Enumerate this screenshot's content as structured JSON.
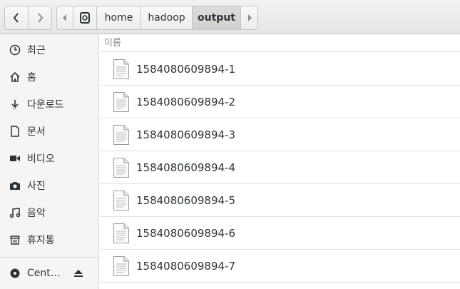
{
  "navigation": {
    "back_icon": "chevron-left-icon",
    "forward_icon": "chevron-right-icon"
  },
  "path_bar": {
    "left_arrow_icon": "scroll-left-icon",
    "root_icon": "drive-icon",
    "crumbs": [
      "home",
      "hadoop",
      "output"
    ],
    "active_crumb": "output",
    "right_arrow_icon": "scroll-right-icon"
  },
  "sidebar": {
    "items": [
      {
        "label": "최근",
        "icon": "clock-icon"
      },
      {
        "label": "홈",
        "icon": "home-icon"
      },
      {
        "label": "다운로드",
        "icon": "download-icon"
      },
      {
        "label": "문서",
        "icon": "document-icon"
      },
      {
        "label": "비디오",
        "icon": "video-icon"
      },
      {
        "label": "사진",
        "icon": "camera-icon"
      },
      {
        "label": "음악",
        "icon": "music-icon"
      },
      {
        "label": "휴지통",
        "icon": "trash-icon"
      }
    ],
    "device": {
      "label": "Cent…",
      "icon": "disc-icon",
      "eject_icon": "eject-icon"
    }
  },
  "file_list": {
    "column_name": "이름",
    "files": [
      "1584080609894-1",
      "1584080609894-2",
      "1584080609894-3",
      "1584080609894-4",
      "1584080609894-5",
      "1584080609894-6",
      "1584080609894-7"
    ]
  }
}
